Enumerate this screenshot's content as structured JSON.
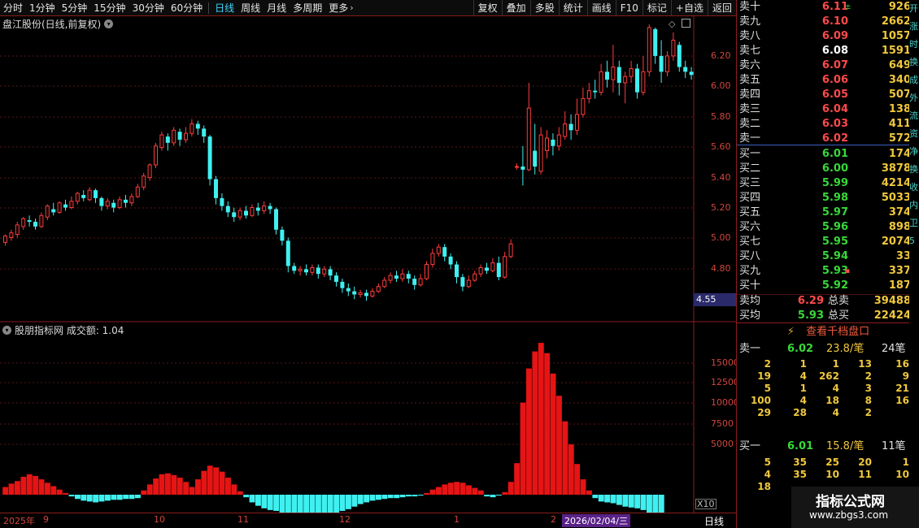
{
  "toolbar": {
    "periods": [
      "分时",
      "1分钟",
      "5分钟",
      "15分钟",
      "30分钟",
      "60分钟",
      "日线",
      "周线",
      "月线",
      "多周期",
      "更多"
    ],
    "active_period": "日线",
    "right_buttons": [
      "复权",
      "叠加",
      "多股",
      "统计",
      "画线",
      "F10",
      "标记",
      "+自选",
      "返回"
    ]
  },
  "main_chart": {
    "title": "盘江股份(日线,前复权)",
    "price_axis_labels": [
      "6.20",
      "6.00",
      "5.80",
      "5.60",
      "5.40",
      "5.20",
      "5.00",
      "4.80"
    ],
    "last_price": "4.55"
  },
  "sub_chart": {
    "title": "股朋指标网 成交额: 1.04",
    "axis_labels": [
      "15000",
      "12500",
      "10000",
      "7500",
      "5000"
    ],
    "unit_label": "X10"
  },
  "bottom_bar": {
    "year_label": "2025年",
    "month_labels": [
      "9",
      "10",
      "11",
      "12",
      "1",
      "2"
    ],
    "cursor_date": "2026/02/04/三",
    "period_label": "日线"
  },
  "order_book": {
    "asks": [
      {
        "label": "卖十",
        "price": "6.11",
        "vol": "926",
        "mark": "±"
      },
      {
        "label": "卖九",
        "price": "6.10",
        "vol": "2662"
      },
      {
        "label": "卖八",
        "price": "6.09",
        "vol": "1057"
      },
      {
        "label": "卖七",
        "price": "6.08",
        "vol": "1591"
      },
      {
        "label": "卖六",
        "price": "6.07",
        "vol": "649"
      },
      {
        "label": "卖五",
        "price": "6.06",
        "vol": "340"
      },
      {
        "label": "卖四",
        "price": "6.05",
        "vol": "507"
      },
      {
        "label": "卖三",
        "price": "6.04",
        "vol": "138"
      },
      {
        "label": "卖二",
        "price": "6.03",
        "vol": "411"
      },
      {
        "label": "卖一",
        "price": "6.02",
        "vol": "572"
      }
    ],
    "bids": [
      {
        "label": "买一",
        "price": "6.01",
        "vol": "174"
      },
      {
        "label": "买二",
        "price": "6.00",
        "vol": "3878"
      },
      {
        "label": "买三",
        "price": "5.99",
        "vol": "4214"
      },
      {
        "label": "买四",
        "price": "5.98",
        "vol": "5033"
      },
      {
        "label": "买五",
        "price": "5.97",
        "vol": "374"
      },
      {
        "label": "买六",
        "price": "5.96",
        "vol": "898"
      },
      {
        "label": "买七",
        "price": "5.95",
        "vol": "2074"
      },
      {
        "label": "买八",
        "price": "5.94",
        "vol": "33"
      },
      {
        "label": "买九",
        "price": "5.93",
        "vol": "337",
        "mark": "▪"
      },
      {
        "label": "买十",
        "price": "5.92",
        "vol": "187"
      }
    ],
    "avg_sell": {
      "label": "卖均",
      "price": "6.29",
      "tot_label": "总卖",
      "vol": "39488"
    },
    "avg_buy": {
      "label": "买均",
      "price": "5.93",
      "tot_label": "总买",
      "vol": "22424"
    }
  },
  "level2": {
    "button_label": "查看千档盘口",
    "sell_head": {
      "label": "卖一",
      "price": "6.02",
      "per": "23.8/笔",
      "count": "24笔"
    },
    "sell_rows": [
      [
        "2",
        "1",
        "1",
        "13",
        "16"
      ],
      [
        "19",
        "4",
        "262",
        "2",
        "9"
      ],
      [
        "5",
        "1",
        "4",
        "3",
        "21"
      ],
      [
        "100",
        "4",
        "18",
        "8",
        "16"
      ],
      [
        "29",
        "28",
        "4",
        "2",
        ""
      ]
    ],
    "buy_head": {
      "label": "买一",
      "price": "6.01",
      "per": "15.8/笔",
      "count": "11笔"
    },
    "buy_rows": [
      [
        "5",
        "35",
        "25",
        "20",
        "1"
      ],
      [
        "4",
        "35",
        "10",
        "11",
        "10"
      ],
      [
        "18",
        "",
        "",
        "",
        ""
      ]
    ]
  },
  "right_edge_chars": [
    "开",
    "涨",
    "时",
    "换",
    "成",
    "外",
    "流",
    "资",
    "净",
    "换",
    "收",
    "内",
    "卫",
    "5"
  ],
  "watermark": {
    "line1": "指标公式网",
    "line2": "www.zbgs3.com"
  },
  "colors": {
    "up": "#ff3c3c",
    "down": "#3ff0f0",
    "ask_price": "#ff4a4a",
    "bid_price": "#38d838",
    "volume": "#f0c83c"
  },
  "chart_data": {
    "type": "candlestick",
    "price_ylim": [
      4.55,
      6.35
    ],
    "candles": [
      [
        4.97,
        5.01,
        4.95,
        5.02
      ],
      [
        5.0,
        5.03,
        4.98,
        5.05
      ],
      [
        5.02,
        5.08,
        5.0,
        5.1
      ],
      [
        5.07,
        5.12,
        5.05,
        5.13
      ],
      [
        5.11,
        5.1,
        5.07,
        5.14
      ],
      [
        5.1,
        5.07,
        5.05,
        5.12
      ],
      [
        5.07,
        5.14,
        5.06,
        5.16
      ],
      [
        5.13,
        5.2,
        5.11,
        5.21
      ],
      [
        5.18,
        5.16,
        5.14,
        5.22
      ],
      [
        5.16,
        5.22,
        5.15,
        5.23
      ],
      [
        5.21,
        5.19,
        5.17,
        5.24
      ],
      [
        5.19,
        5.23,
        5.18,
        5.26
      ],
      [
        5.23,
        5.28,
        5.21,
        5.29
      ],
      [
        5.27,
        5.25,
        5.23,
        5.3
      ],
      [
        5.24,
        5.3,
        5.23,
        5.32
      ],
      [
        5.3,
        5.25,
        5.22,
        5.31
      ],
      [
        5.25,
        5.2,
        5.17,
        5.26
      ],
      [
        5.2,
        5.23,
        5.18,
        5.25
      ],
      [
        5.22,
        5.19,
        5.16,
        5.24
      ],
      [
        5.19,
        5.24,
        5.18,
        5.26
      ],
      [
        5.24,
        5.22,
        5.19,
        5.27
      ],
      [
        5.22,
        5.26,
        5.2,
        5.28
      ],
      [
        5.26,
        5.32,
        5.25,
        5.34
      ],
      [
        5.32,
        5.39,
        5.3,
        5.41
      ],
      [
        5.38,
        5.46,
        5.36,
        5.47
      ],
      [
        5.46,
        5.58,
        5.44,
        5.6
      ],
      [
        5.57,
        5.65,
        5.55,
        5.67
      ],
      [
        5.64,
        5.6,
        5.55,
        5.66
      ],
      [
        5.6,
        5.68,
        5.58,
        5.7
      ],
      [
        5.67,
        5.62,
        5.58,
        5.69
      ],
      [
        5.62,
        5.66,
        5.6,
        5.7
      ],
      [
        5.66,
        5.72,
        5.64,
        5.75
      ],
      [
        5.72,
        5.69,
        5.65,
        5.74
      ],
      [
        5.69,
        5.64,
        5.6,
        5.71
      ],
      [
        5.64,
        5.37,
        5.33,
        5.65
      ],
      [
        5.37,
        5.25,
        5.21,
        5.39
      ],
      [
        5.25,
        5.2,
        5.17,
        5.28
      ],
      [
        5.2,
        5.16,
        5.13,
        5.23
      ],
      [
        5.16,
        5.13,
        5.1,
        5.19
      ],
      [
        5.13,
        5.17,
        5.11,
        5.19
      ],
      [
        5.17,
        5.14,
        5.12,
        5.2
      ],
      [
        5.14,
        5.19,
        5.13,
        5.21
      ],
      [
        5.19,
        5.17,
        5.14,
        5.22
      ],
      [
        5.17,
        5.2,
        5.15,
        5.23
      ],
      [
        5.2,
        5.18,
        5.15,
        5.22
      ],
      [
        5.18,
        5.05,
        5.02,
        5.19
      ],
      [
        5.05,
        4.98,
        4.95,
        5.07
      ],
      [
        4.98,
        4.82,
        4.78,
        5.0
      ],
      [
        4.82,
        4.79,
        4.77,
        4.84
      ],
      [
        4.79,
        4.8,
        4.76,
        4.82
      ],
      [
        4.8,
        4.78,
        4.76,
        4.83
      ],
      [
        4.78,
        4.81,
        4.76,
        4.83
      ],
      [
        4.81,
        4.77,
        4.74,
        4.83
      ],
      [
        4.77,
        4.8,
        4.75,
        4.82
      ],
      [
        4.8,
        4.76,
        4.73,
        4.82
      ],
      [
        4.76,
        4.72,
        4.69,
        4.78
      ],
      [
        4.72,
        4.68,
        4.65,
        4.74
      ],
      [
        4.68,
        4.66,
        4.63,
        4.71
      ],
      [
        4.66,
        4.64,
        4.61,
        4.69
      ],
      [
        4.64,
        4.65,
        4.62,
        4.67
      ],
      [
        4.65,
        4.63,
        4.6,
        4.67
      ],
      [
        4.63,
        4.66,
        4.62,
        4.68
      ],
      [
        4.66,
        4.69,
        4.65,
        4.71
      ],
      [
        4.69,
        4.73,
        4.68,
        4.75
      ],
      [
        4.73,
        4.76,
        4.71,
        4.78
      ],
      [
        4.76,
        4.74,
        4.72,
        4.79
      ],
      [
        4.74,
        4.77,
        4.72,
        4.8
      ],
      [
        4.77,
        4.74,
        4.71,
        4.79
      ],
      [
        4.74,
        4.7,
        4.67,
        4.76
      ],
      [
        4.7,
        4.74,
        4.69,
        4.77
      ],
      [
        4.74,
        4.83,
        4.73,
        4.85
      ],
      [
        4.83,
        4.9,
        4.81,
        4.93
      ],
      [
        4.9,
        4.94,
        4.88,
        4.96
      ],
      [
        4.94,
        4.88,
        4.85,
        4.96
      ],
      [
        4.88,
        4.83,
        4.8,
        4.9
      ],
      [
        4.83,
        4.75,
        4.71,
        4.85
      ],
      [
        4.75,
        4.69,
        4.66,
        4.77
      ],
      [
        4.69,
        4.73,
        4.68,
        4.76
      ],
      [
        4.73,
        4.77,
        4.72,
        4.79
      ],
      [
        4.77,
        4.81,
        4.75,
        4.83
      ],
      [
        4.81,
        4.79,
        4.77,
        4.84
      ],
      [
        4.79,
        4.84,
        4.78,
        4.87
      ],
      [
        4.84,
        4.75,
        4.73,
        4.88
      ],
      [
        4.75,
        4.88,
        4.74,
        4.91
      ],
      [
        4.88,
        4.96,
        4.87,
        4.99
      ],
      [
        5.45,
        5.45,
        5.43,
        5.47
      ],
      [
        5.45,
        5.43,
        5.33,
        5.58
      ],
      [
        5.43,
        5.82,
        5.42,
        5.98
      ],
      [
        5.55,
        5.45,
        5.4,
        5.72
      ],
      [
        5.42,
        5.65,
        5.4,
        5.7
      ],
      [
        5.55,
        5.63,
        5.5,
        5.68
      ],
      [
        5.62,
        5.58,
        5.52,
        5.66
      ],
      [
        5.58,
        5.65,
        5.55,
        5.7
      ],
      [
        5.64,
        5.72,
        5.62,
        5.8
      ],
      [
        5.72,
        5.68,
        5.62,
        5.78
      ],
      [
        5.68,
        5.78,
        5.65,
        5.88
      ],
      [
        5.78,
        5.88,
        5.76,
        5.95
      ],
      [
        5.88,
        5.93,
        5.85,
        5.98
      ],
      [
        5.93,
        5.92,
        5.88,
        6.0
      ],
      [
        5.92,
        6.05,
        5.9,
        6.1
      ],
      [
        6.05,
        6.0,
        5.95,
        6.12
      ],
      [
        6.0,
        6.08,
        5.92,
        6.22
      ],
      [
        6.08,
        5.98,
        5.9,
        6.12
      ],
      [
        5.98,
        6.02,
        5.85,
        6.05
      ],
      [
        6.02,
        6.07,
        5.98,
        6.12
      ],
      [
        6.07,
        5.92,
        5.88,
        6.1
      ],
      [
        5.92,
        6.05,
        5.9,
        6.15
      ],
      [
        6.05,
        6.33,
        6.02,
        6.35
      ],
      [
        6.32,
        6.15,
        6.1,
        6.33
      ],
      [
        6.15,
        6.05,
        5.98,
        6.25
      ],
      [
        6.05,
        6.15,
        6.02,
        6.18
      ],
      [
        6.15,
        6.25,
        6.12,
        6.3
      ],
      [
        6.22,
        6.08,
        6.05,
        6.24
      ],
      [
        6.08,
        6.05,
        6.01,
        6.12
      ],
      [
        6.05,
        6.03,
        6.0,
        6.08
      ]
    ],
    "volume_ylim": [
      -2000,
      18000
    ],
    "volume": [
      900,
      1300,
      1600,
      2100,
      2400,
      2200,
      1800,
      1400,
      1000,
      600,
      200,
      -200,
      -500,
      -700,
      -800,
      -900,
      -800,
      -700,
      -600,
      -600,
      -500,
      -500,
      -400,
      500,
      1200,
      1900,
      2400,
      2500,
      2300,
      2000,
      1500,
      900,
      1800,
      2800,
      3400,
      3200,
      2700,
      2000,
      1200,
      400,
      -300,
      -900,
      -1300,
      -1600,
      -1800,
      -1900,
      -2100,
      -2300,
      -2500,
      -2700,
      -2800,
      -2800,
      -2700,
      -2500,
      -2300,
      -2100,
      -1900,
      -1700,
      -1400,
      -1100,
      -900,
      -700,
      -600,
      -500,
      -400,
      -400,
      -300,
      -200,
      -200,
      -100,
      200,
      600,
      900,
      1200,
      1400,
      1500,
      1400,
      1100,
      800,
      500,
      -200,
      -300,
      -100,
      300,
      1500,
      3700,
      10800,
      14800,
      16800,
      17800,
      16600,
      14200,
      11600,
      8600,
      5900,
      3600,
      1800,
      500,
      -400,
      -800,
      -900,
      -1000,
      -1200,
      -1400,
      -1500,
      -1600,
      -1800,
      -2100,
      -2400,
      -4200
    ]
  }
}
